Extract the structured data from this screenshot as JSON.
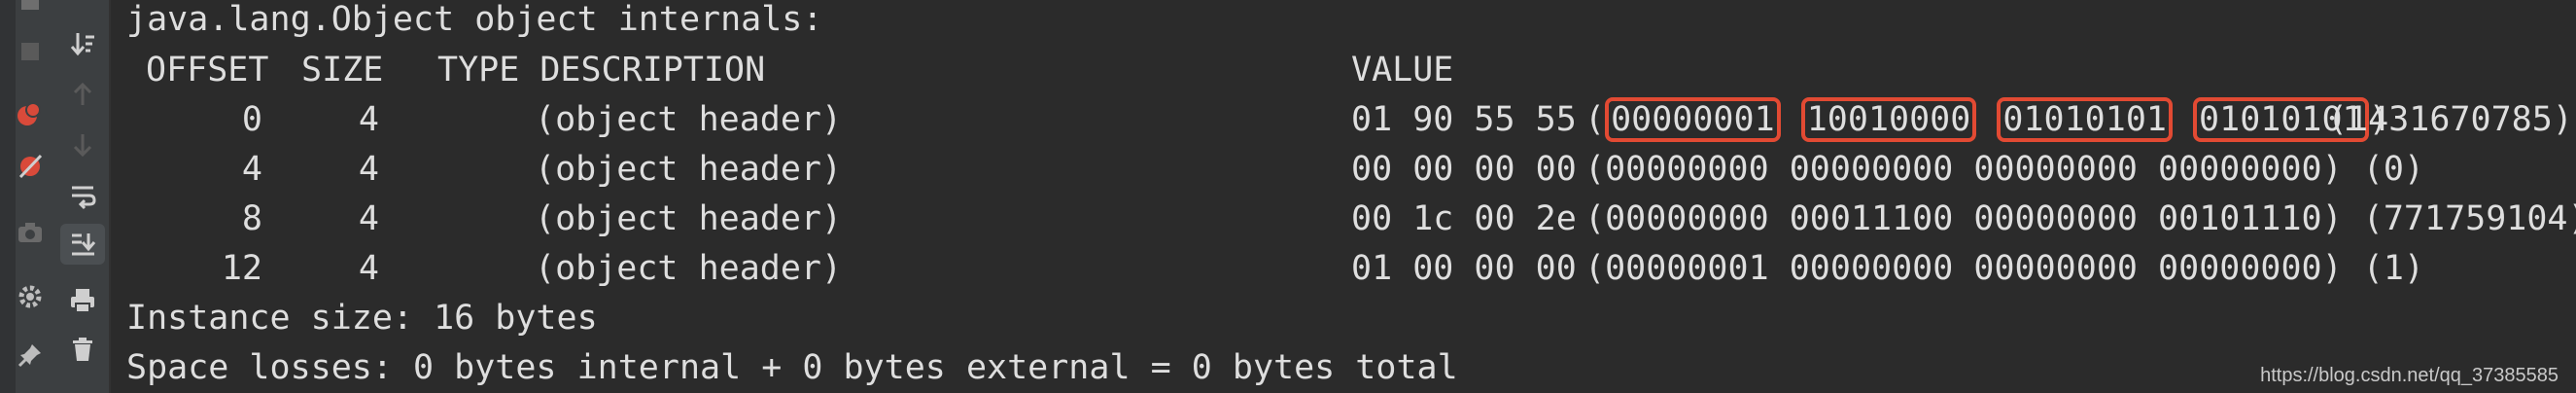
{
  "console": {
    "heading": "java.lang.Object object internals:",
    "columns": {
      "offset": "OFFSET",
      "size": "SIZE",
      "type_description": "TYPE DESCRIPTION",
      "value": "VALUE"
    },
    "rows": [
      {
        "offset": "0",
        "size": "4",
        "description": "(object header)",
        "hex": "01 90 55 55",
        "bin": [
          "00000001",
          "10010000",
          "01010101",
          "01010101"
        ],
        "decimal": "(1431670785)"
      },
      {
        "offset": "4",
        "size": "4",
        "description": "(object header)",
        "hex": "00 00 00 00",
        "bin": [
          "00000000",
          "00000000",
          "00000000",
          "00000000"
        ],
        "decimal": "(0)"
      },
      {
        "offset": "8",
        "size": "4",
        "description": "(object header)",
        "hex": "00 1c 00 2e",
        "bin": [
          "00000000",
          "00011100",
          "00000000",
          "00101110"
        ],
        "decimal": "(771759104)"
      },
      {
        "offset": "12",
        "size": "4",
        "description": "(object header)",
        "hex": "01 00 00 00",
        "bin": [
          "00000001",
          "00000000",
          "00000000",
          "00000000"
        ],
        "decimal": "(1)"
      }
    ],
    "instance_size": "Instance size: 16 bytes",
    "space_losses": "Space losses: 0 bytes internal + 0 bytes external = 0 bytes total"
  },
  "watermark": "https://blog.csdn.net/qq_37385585",
  "toolbar": {
    "icons": [
      "step-over-icon",
      "sort-down-icon",
      "up-arrow-icon",
      "down-arrow-icon",
      "soft-wrap-icon",
      "scroll-to-end-icon",
      "camera-icon",
      "print-icon",
      "settings-icon",
      "trash-icon",
      "pin-icon",
      "stop-icon",
      "breakpoint-icon",
      "mute-breakpoints-icon"
    ]
  },
  "colors": {
    "background": "#2b2b2b",
    "text": "#dedede",
    "highlight_border": "#e24a33",
    "toolbar_bg": "#3c3f41"
  }
}
